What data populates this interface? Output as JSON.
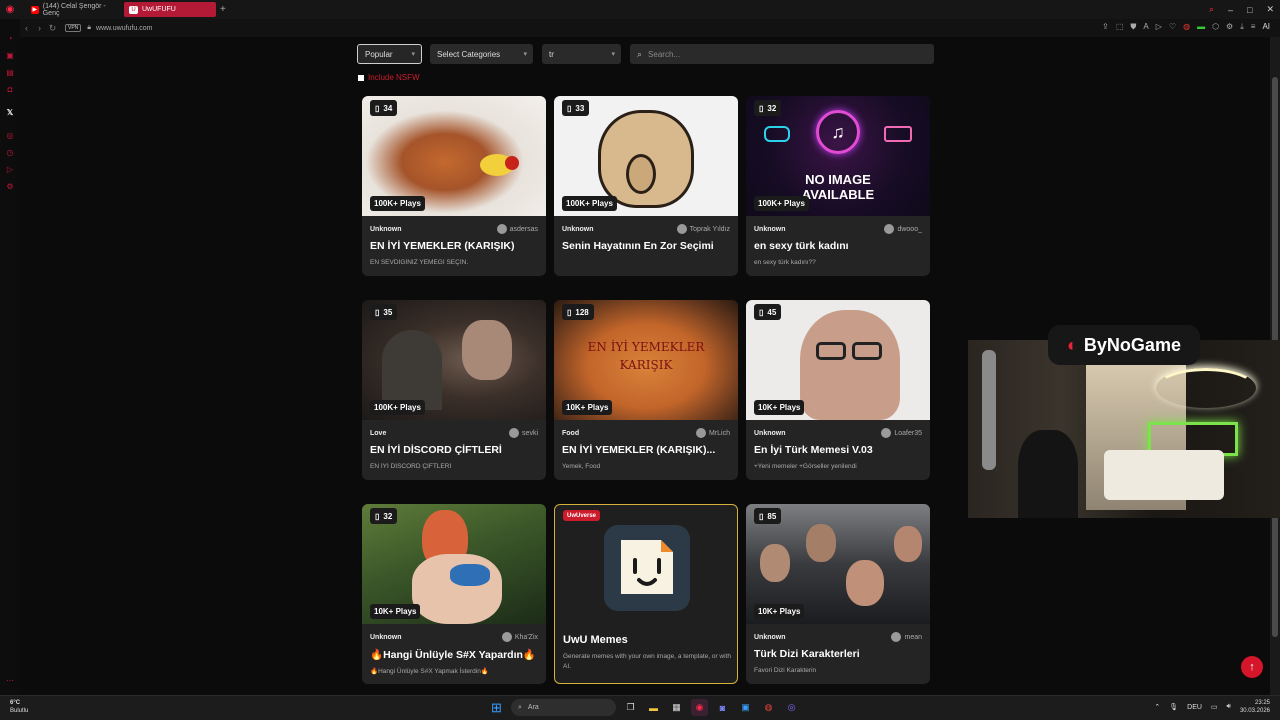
{
  "browser": {
    "tabs": [
      {
        "label": "(144) Celal Şengör - Genç"
      },
      {
        "label": "UwUFUFU"
      }
    ],
    "url": "www.uwufufu.com",
    "vpn": "VPN",
    "ai": "AI"
  },
  "filters": {
    "sort": "Popular",
    "category": "Select Categories",
    "language": "tr",
    "search_placeholder": "Search..."
  },
  "nsfw_label": "Include NSFW",
  "cards": [
    {
      "count": "34",
      "plays": "100K+ Plays",
      "category": "Unknown",
      "author": "asdersas",
      "title": "EN İYİ YEMEKLER (KARIŞIK)",
      "desc": "EN SEVDİĞİNİZ YEMEĞİ SEÇİN."
    },
    {
      "count": "33",
      "plays": "100K+ Plays",
      "category": "Unknown",
      "author": "Toprak Yıldız",
      "title": "Senin Hayatının En Zor Seçimi",
      "desc": ""
    },
    {
      "count": "32",
      "plays": "100K+ Plays",
      "category": "Unknown",
      "author": "dwooo_",
      "title": "en sexy türk kadını",
      "desc": "en sexy türk kadını??",
      "noimage": "NO IMAGE AVAILABLE"
    },
    {
      "count": "35",
      "plays": "100K+ Plays",
      "category": "Love",
      "author": "sevki",
      "title": "EN İYİ DİSCORD ÇİFTLERİ",
      "desc": "EN İYİ DİSCORD ÇİFTLERİ"
    },
    {
      "count": "128",
      "plays": "10K+ Plays",
      "category": "Food",
      "author": "MrLich",
      "title": "EN İYİ YEMEKLER (KARIŞIK)...",
      "desc": "Yemek, Food",
      "overlay": "EN İYİ YEMEKLER KARIŞIK"
    },
    {
      "count": "45",
      "plays": "10K+ Plays",
      "category": "Unknown",
      "author": "Loafer35",
      "title": "En İyi Türk Memesi V.03",
      "desc": "+Yeni memeler +Görseller yenilendi"
    },
    {
      "count": "32",
      "plays": "10K+ Plays",
      "category": "Unknown",
      "author": "Kha'Zix",
      "title": "🔥Hangi Ünlüyle S#X Yapardın🔥",
      "desc": "🔥Hangi Ünlüyle S#X Yapmak İsterdin🔥"
    },
    {
      "count": "85",
      "plays": "10K+ Plays",
      "category": "Unknown",
      "author": "mean",
      "title": "Türk Dizi Karakterleri",
      "desc": "Favori Dizi Karakterin"
    }
  ],
  "uwu": {
    "tag": "UwUverse",
    "title": "UwU Memes",
    "desc": "Generate memes with your own image, a template, or with AI."
  },
  "stream": {
    "logo": "ByNoGame"
  },
  "taskbar": {
    "weather_temp": "6°C",
    "weather_desc": "Bulutlu",
    "search": "Ara",
    "lang": "DEU",
    "time": "23:25",
    "date": "30.03.2026"
  },
  "colors": {
    "accent": "#c3173a",
    "uwu_border": "#d4b13a",
    "fab": "#d5162a"
  }
}
